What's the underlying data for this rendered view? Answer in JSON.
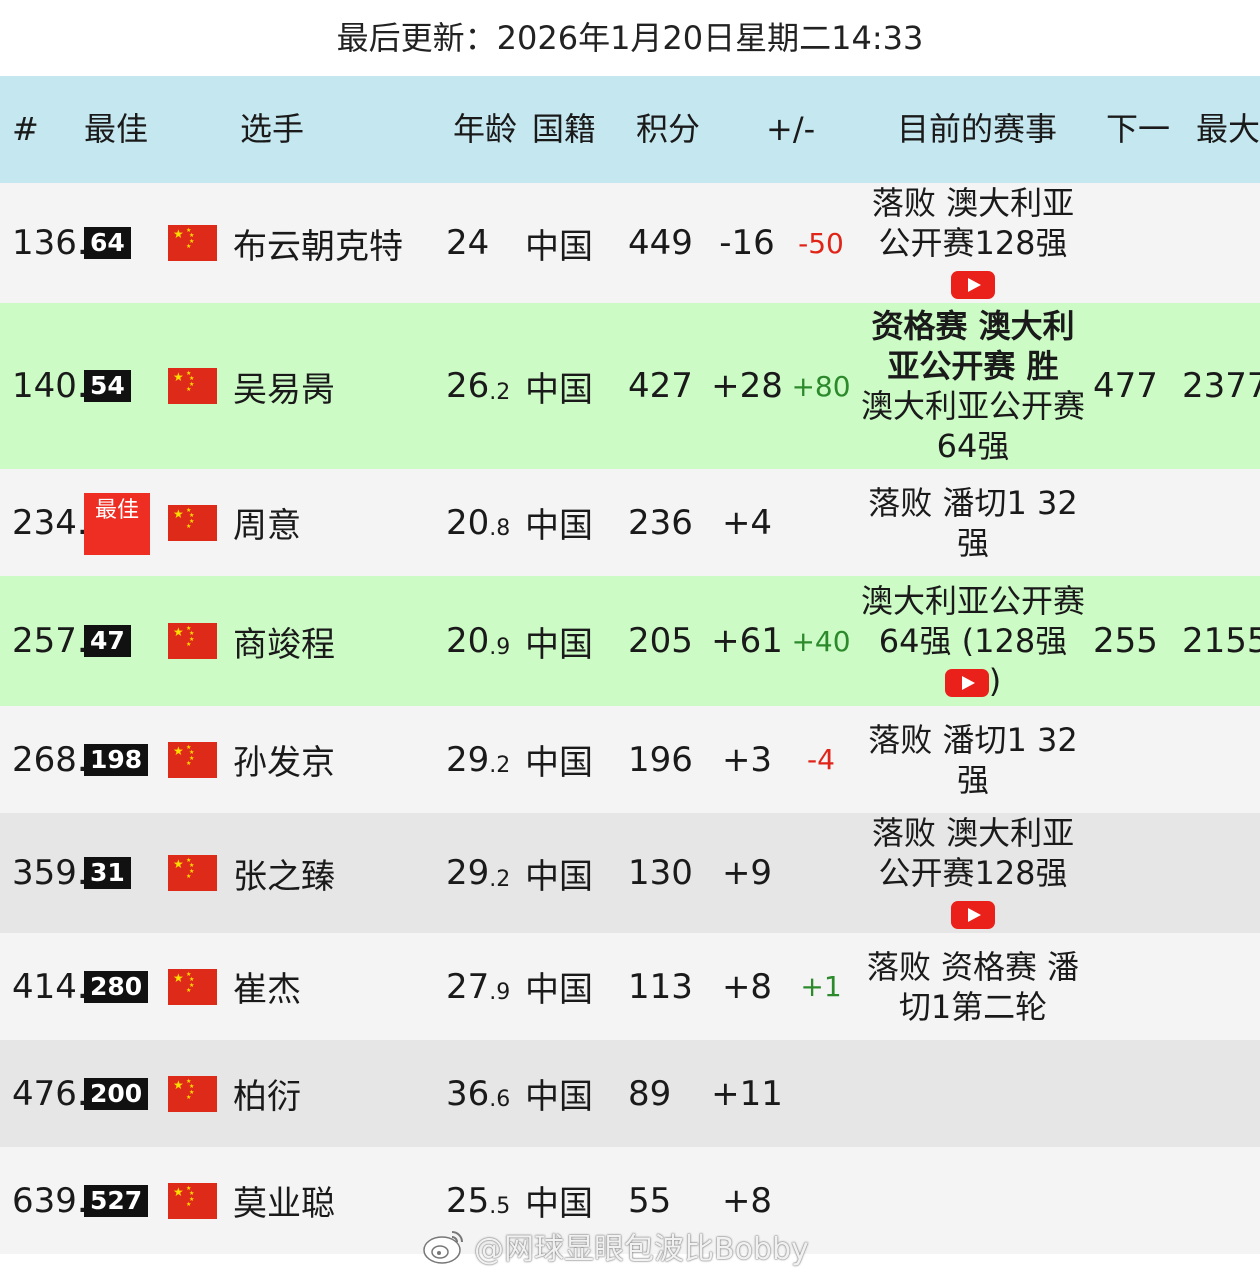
{
  "updated": "最后更新：2026年1月20日星期二14:33",
  "header": {
    "rank": "#",
    "best": "最佳",
    "player": "选手",
    "age": "年龄",
    "nationality": "国籍",
    "points": "积分",
    "pm": "+/-",
    "event": "目前的赛事",
    "next": "下一",
    "max": "最大"
  },
  "rows": [
    {
      "rank": "136.",
      "best": "64",
      "name": "布云朝克特",
      "age": "24",
      "age_sub": "",
      "nat": "中国",
      "pts": "449",
      "pm": "-16",
      "delta": "-50",
      "event_bold": "",
      "event": "落败 澳大利亚公开赛128强",
      "youtube": true,
      "next": "",
      "max": ""
    },
    {
      "rank": "140.",
      "best": "54",
      "name": "吴易昺",
      "age": "26",
      "age_sub": ".2",
      "nat": "中国",
      "pts": "427",
      "pm": "+28",
      "delta": "+80",
      "event_bold": "资格赛 澳大利亚公开赛 胜",
      "event": "澳大利亚公开赛64强",
      "youtube": false,
      "next": "477",
      "max": "2377"
    },
    {
      "rank": "234.",
      "best": "最佳",
      "name": "周意",
      "age": "20",
      "age_sub": ".8",
      "nat": "中国",
      "pts": "236",
      "pm": "+4",
      "delta": "",
      "event_bold": "",
      "event": "落败 潘切1 32强",
      "youtube": false,
      "next": "",
      "max": ""
    },
    {
      "rank": "257.",
      "best": "47",
      "name": "商竣程",
      "age": "20",
      "age_sub": ".9",
      "nat": "中国",
      "pts": "205",
      "pm": "+61",
      "delta": "+40",
      "event_bold": "",
      "event": "澳大利亚公开赛64强 (128强",
      "event_tail": ")",
      "youtube": true,
      "next": "255",
      "max": "2155"
    },
    {
      "rank": "268.",
      "best": "198",
      "name": "孙发京",
      "age": "29",
      "age_sub": ".2",
      "nat": "中国",
      "pts": "196",
      "pm": "+3",
      "delta": "-4",
      "event_bold": "",
      "event": "落败 潘切1 32强",
      "youtube": false,
      "next": "",
      "max": ""
    },
    {
      "rank": "359.",
      "best": "31",
      "name": "张之臻",
      "age": "29",
      "age_sub": ".2",
      "nat": "中国",
      "pts": "130",
      "pm": "+9",
      "delta": "",
      "event_bold": "",
      "event": "落败 澳大利亚公开赛128强",
      "youtube": true,
      "next": "",
      "max": ""
    },
    {
      "rank": "414.",
      "best": "280",
      "name": "崔杰",
      "age": "27",
      "age_sub": ".9",
      "nat": "中国",
      "pts": "113",
      "pm": "+8",
      "delta": "+1",
      "event_bold": "",
      "event": "落败 资格赛 潘切1第二轮",
      "youtube": false,
      "next": "",
      "max": ""
    },
    {
      "rank": "476.",
      "best": "200",
      "name": "柏衍",
      "age": "36",
      "age_sub": ".6",
      "nat": "中国",
      "pts": "89",
      "pm": "+11",
      "delta": "",
      "event_bold": "",
      "event": "",
      "youtube": false,
      "next": "",
      "max": ""
    },
    {
      "rank": "639.",
      "best": "527",
      "name": "莫业聪",
      "age": "25",
      "age_sub": ".5",
      "nat": "中国",
      "pts": "55",
      "pm": "+8",
      "delta": "",
      "event_bold": "",
      "event": "",
      "youtube": false,
      "next": "",
      "max": ""
    }
  ],
  "watermark": "@网球显眼包波比Bobby",
  "colors": {
    "header_bg": "#c5e7f0",
    "highlight_row": "#ccfbc6",
    "negative": "#e02418",
    "positive": "#2c8a2c",
    "flag_red": "#de2a18"
  },
  "icons": [
    "china-flag-icon",
    "youtube-icon",
    "weibo-icon"
  ]
}
